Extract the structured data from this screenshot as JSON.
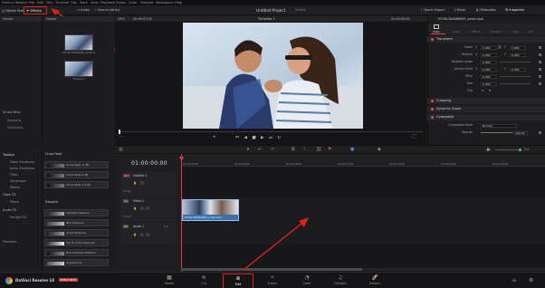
{
  "menubar": {
    "items": [
      "DaVinci Resolve",
      "File",
      "Edit",
      "Trim",
      "Timeline",
      "Clip",
      "Mark",
      "View",
      "Playback",
      "Fusion",
      "Color",
      "Fairlight",
      "Workspace",
      "Help"
    ]
  },
  "toolbar": {
    "media_pool": "Media Pool",
    "effects": "Effects",
    "index": "Index",
    "sound_library": "Sound Library",
    "project_title": "Untitled Project",
    "project_status": "Edited",
    "quick_export": "Quick Export",
    "mixer": "Mixer",
    "metadata": "Metadata",
    "inspector": "Inspector"
  },
  "media_pool": {
    "tree_header": "Master",
    "bin_header": "Master",
    "clips": [
      {
        "name": "19706-304686900_small.mp4"
      },
      {
        "name": "Timeline 1"
      }
    ],
    "smart_bins": "Smart Bins",
    "smart_items": [
      "Keywords",
      "Collections"
    ]
  },
  "viewer": {
    "zoom": "34%",
    "timecode_left": "00:00:07:00",
    "timeline_name": "Timeline 1",
    "timecode_right": "01:00:00:00"
  },
  "inspector": {
    "clip_name": "19706-304686900_small.mp4",
    "tabs": [
      "Video",
      "Audio",
      "Effects",
      "Transition",
      "Image",
      "File"
    ],
    "transform": {
      "title": "Transform",
      "rows": [
        {
          "label": "Zoom",
          "x_label": "X",
          "x": "1.000",
          "y_label": "Y",
          "y": "1.000"
        },
        {
          "label": "Position",
          "x_label": "X",
          "x": "0.000",
          "y_label": "Y",
          "y": "0.000"
        },
        {
          "label": "Rotation Angle",
          "x": "0.000"
        },
        {
          "label": "Anchor Point",
          "x_label": "X",
          "x": "0.000",
          "y_label": "Y",
          "y": "0.000"
        },
        {
          "label": "Pitch",
          "x": "0.000"
        },
        {
          "label": "Yaw",
          "x": "0.000"
        },
        {
          "label": "Flip"
        }
      ]
    },
    "sections": [
      "Cropping",
      "Dynamic Zoom",
      "Composite"
    ],
    "composite_mode_label": "Composite Mode",
    "composite_mode_value": "Normal",
    "opacity_label": "Opacity",
    "opacity_value": "100.00"
  },
  "effects_panel": {
    "toolbox_title": "Toolbox",
    "toolbox_items": [
      "Video Transitions",
      "Audio Transitions",
      "Titles",
      "Generators",
      "Effects"
    ],
    "openfx_title": "Open FX",
    "openfx_items": [
      "Filters"
    ],
    "audiofx_title": "Audio FX",
    "audiofx_items": [
      "Fairlight FX"
    ],
    "favorites": "Favorites",
    "cross_fade_header": "Cross Fade",
    "cross_fade_items": [
      "Cross Fade -3 dB",
      "Cross Fade 0 dB",
      "Cross Fade +3 dB"
    ],
    "dissolve_header": "Dissolve",
    "dissolve_items": [
      "Additive Dissolve",
      "Blur Dissolve",
      "Cross Dissolve",
      "Dip To Color Dissolve",
      "Non-Additive Dissolve",
      "Smooth Cut"
    ]
  },
  "timeline": {
    "timecode": "01:00:00:00",
    "ruler_marks": [
      "01:00:00:00",
      "01:00:04:00",
      "01:00:08:00",
      "01:00:12:00",
      "01:00:16:00",
      "01:00:20:00",
      "01:00:24:00"
    ],
    "tracks": [
      {
        "id": "ST1",
        "name": "Subtitle 1",
        "count": "0 Clip"
      },
      {
        "id": "V1",
        "name": "Video 1",
        "count": "1 Clip"
      },
      {
        "id": "A1",
        "name": "Audio 1",
        "count": "2.0"
      }
    ],
    "clip_name": "19706-304686900_small.mp4",
    "volume_value": "0.0"
  },
  "brand": {
    "name": "DaVinci Resolve 18",
    "badge": "PUBLIC BETA"
  },
  "pages": [
    {
      "label": "Media",
      "icon": "media-icon"
    },
    {
      "label": "Cut",
      "icon": "cut-icon"
    },
    {
      "label": "Edit",
      "icon": "edit-icon"
    },
    {
      "label": "Fusion",
      "icon": "fusion-icon"
    },
    {
      "label": "Color",
      "icon": "color-icon"
    },
    {
      "label": "Fairlight",
      "icon": "fairlight-icon"
    },
    {
      "label": "Deliver",
      "icon": "deliver-icon"
    }
  ],
  "colors": {
    "annotation": "#e0201b",
    "accent": "#e0474c",
    "playhead": "#e5383b",
    "clip_blue": "#3f6fa8"
  }
}
